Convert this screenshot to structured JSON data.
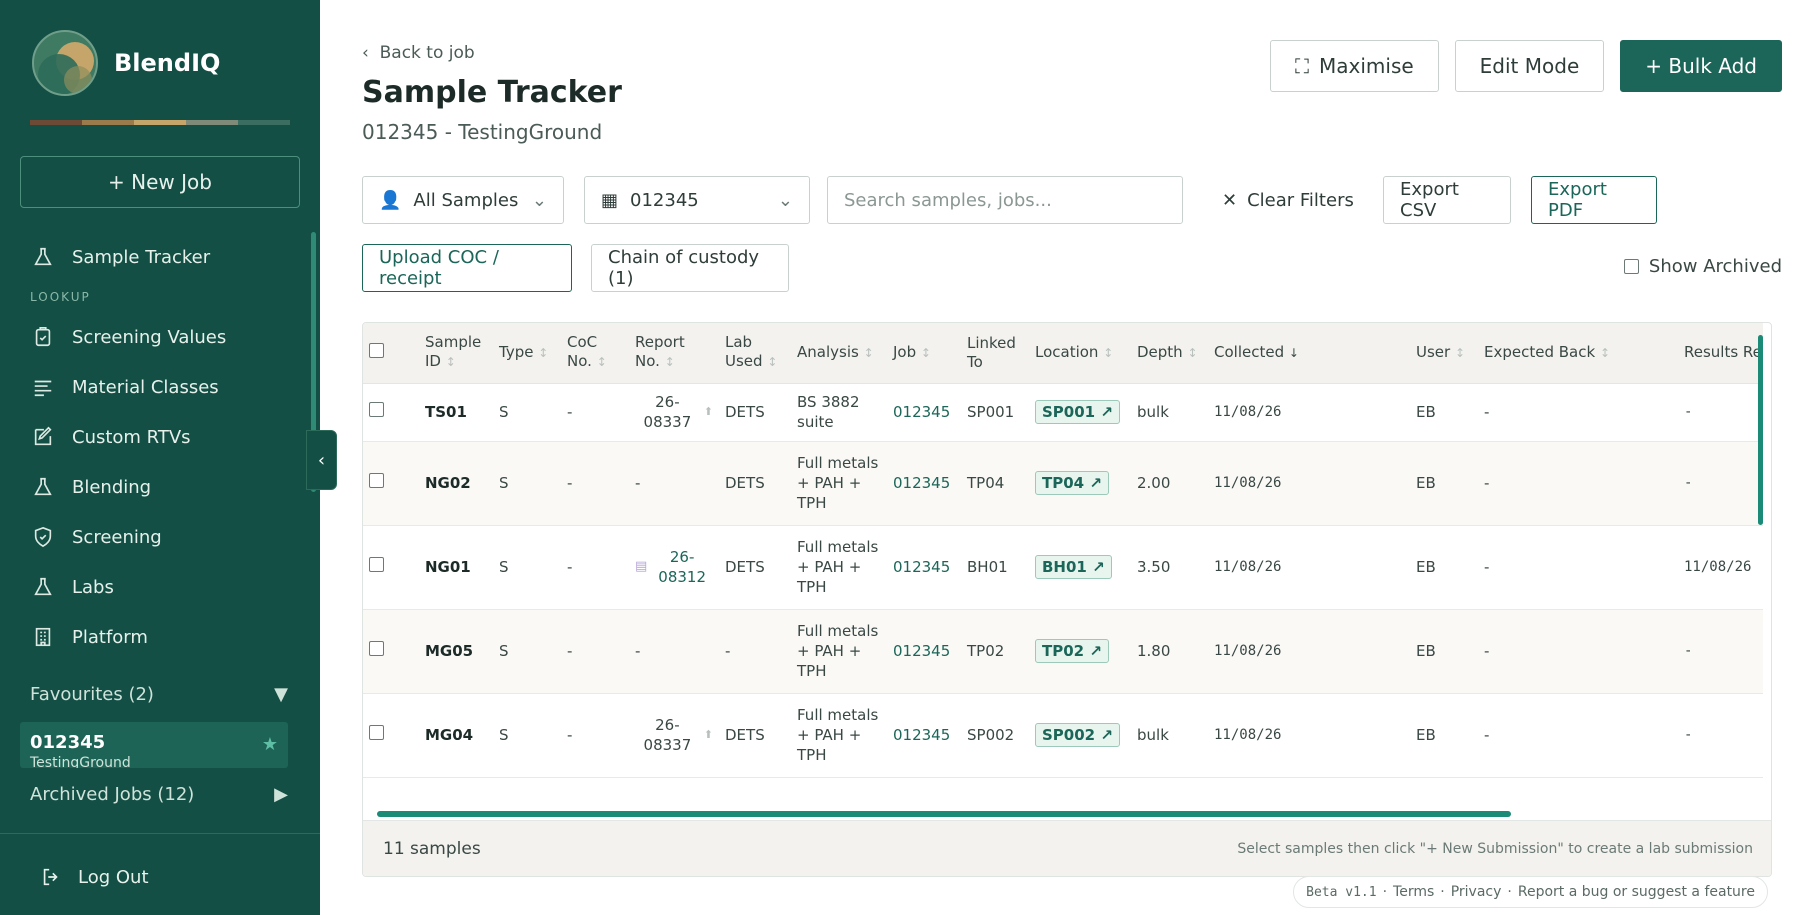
{
  "app": {
    "name": "BlendIQ",
    "palette": [
      "#6d4a35",
      "#9b7b4c",
      "#c5a56a",
      "#7f8a79",
      "#3b6e60"
    ]
  },
  "sidebar": {
    "new_job": "+ New Job",
    "items": [
      {
        "label": "Sample Tracker",
        "icon": "flask-icon"
      },
      {
        "label": "Screening Values",
        "icon": "clipboard-check-icon"
      },
      {
        "label": "Material Classes",
        "icon": "list-icon"
      },
      {
        "label": "Custom RTVs",
        "icon": "edit-icon"
      },
      {
        "label": "Blending",
        "icon": "flask-icon"
      },
      {
        "label": "Screening",
        "icon": "shield-check-icon"
      },
      {
        "label": "Labs",
        "icon": "flask-icon"
      },
      {
        "label": "Platform",
        "icon": "building-icon"
      }
    ],
    "lookup_label": "LOOKUP",
    "favourites_label": "Favourites (2)",
    "favourite_item": {
      "title": "012345",
      "subtitle": "TestingGround"
    },
    "archived_label": "Archived Jobs (12)",
    "logout": "Log Out"
  },
  "header": {
    "back": "Back to job",
    "title": "Sample Tracker",
    "subtitle": "012345 - TestingGround",
    "maximise": "Maximise",
    "edit_mode": "Edit Mode",
    "bulk_add": "+ Bulk Add"
  },
  "filters": {
    "samples": "All Samples",
    "job": "012345",
    "search_placeholder": "Search samples, jobs...",
    "clear": "Clear Filters",
    "export_csv": "Export CSV",
    "export_pdf": "Export PDF",
    "upload_coc": "Upload COC / receipt",
    "chain": "Chain of custody (1)",
    "show_archived": "Show Archived"
  },
  "table": {
    "columns": [
      "Sample ID",
      "Type",
      "CoC No.",
      "Report No.",
      "Lab Used",
      "Analysis",
      "Job",
      "Linked To",
      "Location",
      "Depth",
      "Collected",
      "User",
      "Expected Back",
      "Results Rec"
    ],
    "rows": [
      {
        "id": "TS01",
        "type": "S",
        "coc": "-",
        "report": "26-08337",
        "report_doc": false,
        "lab": "DETS",
        "analysis": "BS 3882 suite",
        "job": "012345",
        "linked": "SP001",
        "location": "SP001 ↗",
        "depth": "bulk",
        "collected": "11/08/26",
        "user": "EB",
        "expected": "-",
        "results": "-"
      },
      {
        "id": "NG02",
        "type": "S",
        "coc": "-",
        "report": "-",
        "report_doc": false,
        "lab": "DETS",
        "analysis": "Full metals + PAH + TPH",
        "job": "012345",
        "linked": "TP04",
        "location": "TP04 ↗",
        "depth": "2.00",
        "collected": "11/08/26",
        "user": "EB",
        "expected": "-",
        "results": "-"
      },
      {
        "id": "NG01",
        "type": "S",
        "coc": "-",
        "report": "26-08312",
        "report_doc": true,
        "lab": "DETS",
        "analysis": "Full metals + PAH + TPH",
        "job": "012345",
        "linked": "BH01",
        "location": "BH01 ↗",
        "depth": "3.50",
        "collected": "11/08/26",
        "user": "EB",
        "expected": "-",
        "results": "11/08/26"
      },
      {
        "id": "MG05",
        "type": "S",
        "coc": "-",
        "report": "-",
        "report_doc": false,
        "lab": "-",
        "analysis": "Full metals + PAH + TPH",
        "job": "012345",
        "linked": "TP02",
        "location": "TP02 ↗",
        "depth": "1.80",
        "collected": "11/08/26",
        "user": "EB",
        "expected": "-",
        "results": "-"
      },
      {
        "id": "MG04",
        "type": "S",
        "coc": "-",
        "report": "26-08337",
        "report_doc": false,
        "lab": "DETS",
        "analysis": "Full metals + PAH + TPH",
        "job": "012345",
        "linked": "SP002",
        "location": "SP002 ↗",
        "depth": "bulk",
        "collected": "11/08/26",
        "user": "EB",
        "expected": "-",
        "results": "-"
      }
    ],
    "count": "11 samples",
    "hint": "Select samples then click \"+ New Submission\" to create a lab submission"
  },
  "footer": {
    "version": "Beta v1.1",
    "terms": "Terms",
    "privacy": "Privacy",
    "report": "Report a bug or suggest a feature"
  }
}
